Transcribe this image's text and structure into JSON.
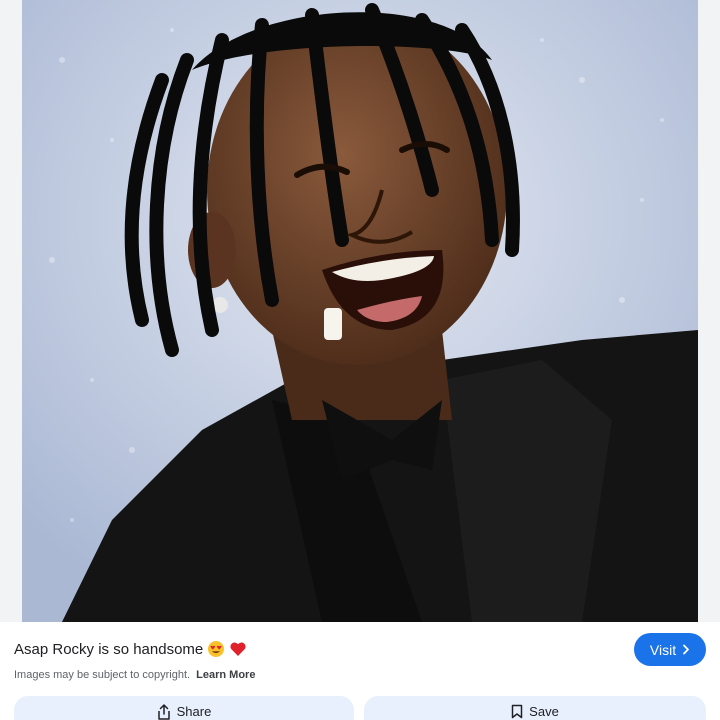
{
  "image": {
    "subject": "photo-laughing-man",
    "background_color": "#c9d3e6"
  },
  "pin": {
    "title": "Asap Rocky is so handsome",
    "title_emojis": [
      "heart-eyes-emoji",
      "red-heart-emoji"
    ],
    "disclaimer": "Images may be subject to copyright.",
    "learn_more_label": "Learn More"
  },
  "buttons": {
    "visit_label": "Visit",
    "share_label": "Share",
    "save_label": "Save"
  },
  "colors": {
    "accent": "#1a73e8",
    "action_bg": "#e8f0fe"
  },
  "icons": {
    "visit": "chevron-right-icon",
    "share": "share-icon",
    "save": "bookmark-icon"
  }
}
